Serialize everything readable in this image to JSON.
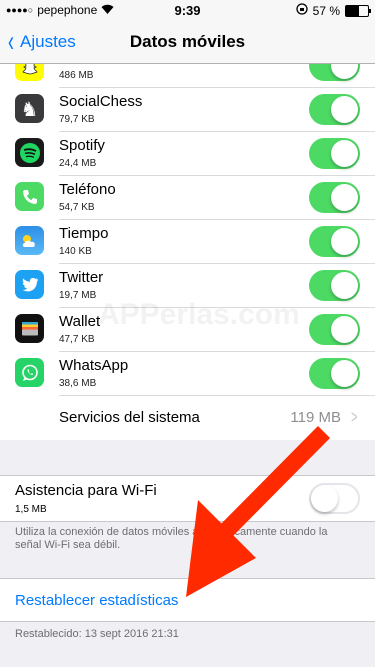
{
  "status": {
    "carrier": "pepephone",
    "time": "9:39",
    "battery": "57 %",
    "battery_level": 0.57
  },
  "nav": {
    "back_label": "Ajustes",
    "title": "Datos móviles"
  },
  "apps": [
    {
      "name": "",
      "size": "486 MB",
      "icon": "snapchat-icon",
      "color": "#fffc00"
    },
    {
      "name": "SocialChess",
      "size": "79,7 KB",
      "icon": "chess-knight-icon",
      "color": "#3a3a3c"
    },
    {
      "name": "Spotify",
      "size": "24,4 MB",
      "icon": "spotify-icon",
      "color": "#1a1a1a"
    },
    {
      "name": "Teléfono",
      "size": "54,7 KB",
      "icon": "phone-icon",
      "color": "#4cd964"
    },
    {
      "name": "Tiempo",
      "size": "140 KB",
      "icon": "weather-icon",
      "color": "#3aa0f0"
    },
    {
      "name": "Twitter",
      "size": "19,7 MB",
      "icon": "twitter-icon",
      "color": "#1da1f2"
    },
    {
      "name": "Wallet",
      "size": "47,7 KB",
      "icon": "wallet-icon",
      "color": "#111111"
    },
    {
      "name": "WhatsApp",
      "size": "38,6 MB",
      "icon": "whatsapp-icon",
      "color": "#25d366"
    }
  ],
  "services": {
    "label": "Servicios del sistema",
    "value": "119 MB"
  },
  "wifi_assist": {
    "label": "Asistencia para Wi-Fi",
    "size": "1,5 MB",
    "enabled": false,
    "note": "Utiliza la conexión de datos móviles automáticamente cuando la señal Wi-Fi sea débil."
  },
  "reset": {
    "label": "Restablecer estadísticas",
    "date": "Restablecido: 13 sept 2016 21:31"
  },
  "colors": {
    "accent": "#007aff",
    "toggle_on": "#4cd964",
    "arrow": "#ff2a00"
  },
  "watermark": "APPerlas.com"
}
